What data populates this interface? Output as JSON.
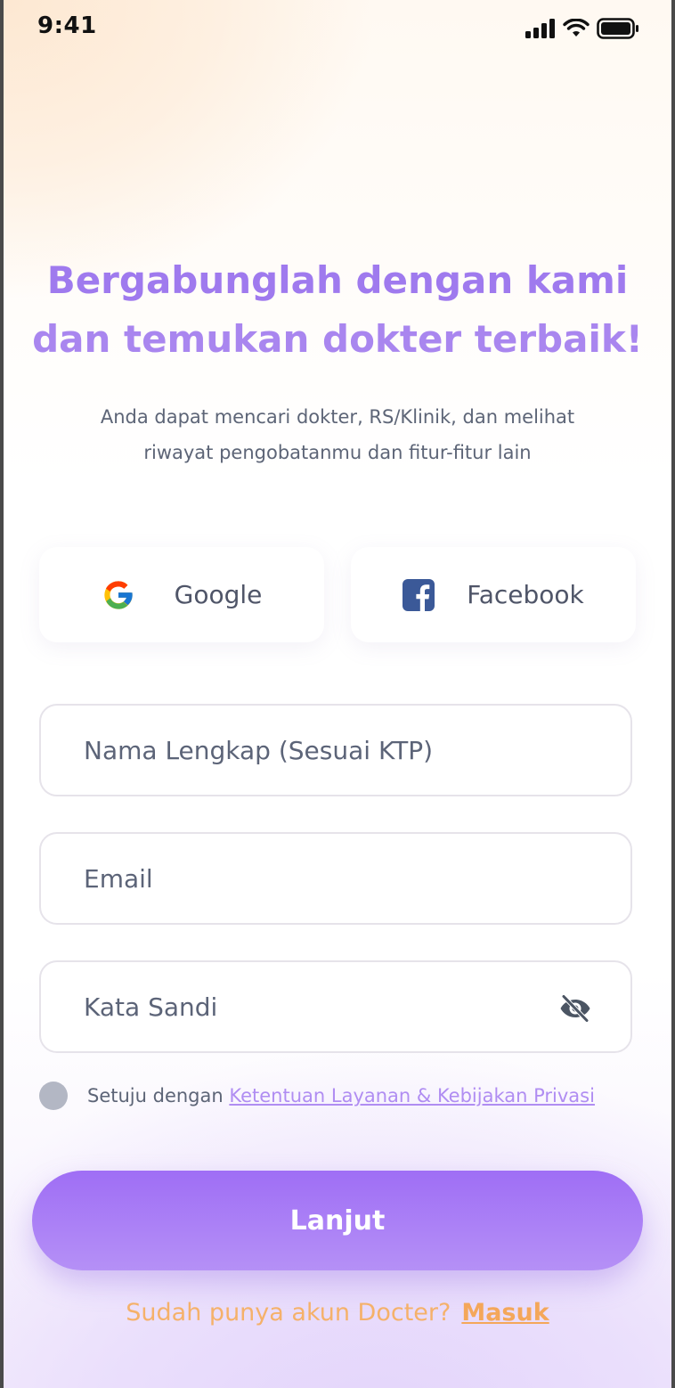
{
  "status_bar": {
    "time": "9:41",
    "icons": [
      "cellular-signal-icon",
      "wifi-icon",
      "battery-icon"
    ]
  },
  "header": {
    "title_line1": "Bergabunglah dengan kami",
    "title_line2": "dan temukan dokter terbaik!",
    "subtitle_line1": "Anda dapat mencari dokter, RS/Klinik, dan melihat",
    "subtitle_line2": "riwayat pengobatanmu dan fitur-fitur lain"
  },
  "social": {
    "google_label": "Google",
    "facebook_label": "Facebook"
  },
  "form": {
    "name_placeholder": "Nama Lengkap (Sesuai KTP)",
    "name_value": "",
    "email_placeholder": "Email",
    "email_value": "",
    "password_placeholder": "Kata Sandi",
    "password_value": "",
    "password_visibility_icon": "eye-off-icon"
  },
  "terms": {
    "checked": false,
    "prefix": "Setuju dengan",
    "link_label": "Ketentuan Layanan & Kebijakan Privasi"
  },
  "actions": {
    "continue_label": "Lanjut"
  },
  "footer": {
    "prompt": "Sudah punya akun Docter?",
    "login_label": "Masuk"
  },
  "colors": {
    "accent_purple": "#9f6ef5",
    "title_purple": "#a57ff0",
    "footer_orange": "#f4a75a",
    "body_text": "#5d6577"
  }
}
